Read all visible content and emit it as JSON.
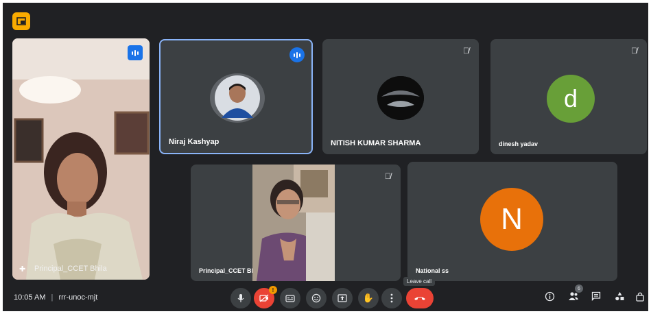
{
  "app_badge": {
    "icon": "picture-in-picture-icon",
    "color": "#f9ab00"
  },
  "participants": [
    {
      "name": "Principal_CCET Bhila",
      "type": "video",
      "speaking": true
    },
    {
      "name": "Niraj Kashyap",
      "type": "photo-avatar",
      "speaking": true,
      "active_border": "#8ab4f8"
    },
    {
      "name": "NITISH KUMAR SHARMA",
      "type": "photo-avatar",
      "muted": true
    },
    {
      "name": "dinesh yadav",
      "type": "letter",
      "letter": "d",
      "avatar_color": "#689f38",
      "muted": true
    },
    {
      "name": "Principal_CCET Bh",
      "type": "video-overlay",
      "muted": true
    },
    {
      "name": "National ss",
      "type": "letter",
      "letter": "N",
      "avatar_color": "#e8710a"
    }
  ],
  "footer": {
    "time": "10:05 AM",
    "separator": "|",
    "meeting_code": "rrr-unoc-mjt",
    "tooltip": "Leave call",
    "notification_count": "!",
    "participants_badge": "6",
    "controls": [
      "mic-icon",
      "camera-off-icon",
      "captions-icon",
      "emoji-icon",
      "present-icon",
      "raise-hand-icon",
      "more-icon",
      "leave-call-icon"
    ],
    "right_icons": [
      "info-icon",
      "people-icon",
      "chat-icon",
      "activities-icon",
      "host-controls-icon"
    ],
    "leave_color": "#ea4335"
  }
}
